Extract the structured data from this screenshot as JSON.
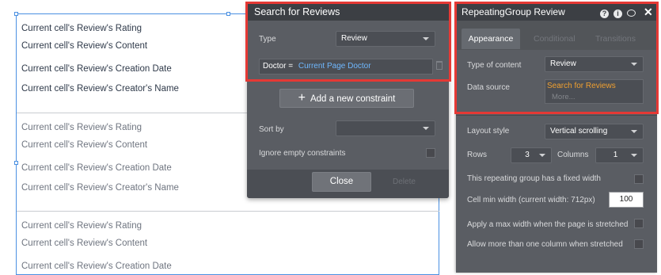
{
  "canvas": {
    "group1": [
      "Current cell's Review's Rating",
      "Current cell's Review's Content",
      "Current cell's Review's Creation Date",
      "Current cell's Review's Creator's Name"
    ],
    "group2": [
      "Current cell's Review's Rating",
      "Current cell's Review's Content",
      "Current cell's Review's Creation Date",
      "Current cell's Review's Creator's Name"
    ],
    "group3": [
      "Current cell's Review's Rating",
      "Current cell's Review's Content",
      "Current cell's Review's Creation Date"
    ]
  },
  "search": {
    "title": "Search for Reviews",
    "type_label": "Type",
    "type_value": "Review",
    "constraint_key": "Doctor =",
    "constraint_value": "Current Page Doctor",
    "add_constraint": "Add a new constraint",
    "sort_label": "Sort by",
    "sort_value": "",
    "ignore_label": "Ignore empty constraints",
    "close": "Close",
    "delete": "Delete"
  },
  "rg": {
    "title": "RepeatingGroup Review",
    "tabs": [
      "Appearance",
      "Conditional",
      "Transitions"
    ],
    "type_label": "Type of content",
    "type_value": "Review",
    "ds_label": "Data source",
    "ds_value": "Search for Reviews",
    "ds_more": "More...",
    "layout_label": "Layout style",
    "layout_value": "Vertical scrolling",
    "rows_label": "Rows",
    "rows_value": "3",
    "cols_label": "Columns",
    "cols_value": "1",
    "fixed_width_label": "This repeating group has a fixed width",
    "cell_min_label": "Cell min width (current width: 712px)",
    "cell_min_value": "100",
    "max_width_label": "Apply a max width when the page is stretched",
    "multi_col_label": "Allow more than one column when stretched"
  },
  "icons": {
    "help": "?",
    "info": "i",
    "close": "✕",
    "add": "+"
  },
  "colors": {
    "highlight": "#e53935",
    "panel": "#5a5d63",
    "title_bar": "#3c3f44",
    "link": "#6fb8ff",
    "data_source": "#f0a030",
    "selection": "#4a90e2"
  }
}
